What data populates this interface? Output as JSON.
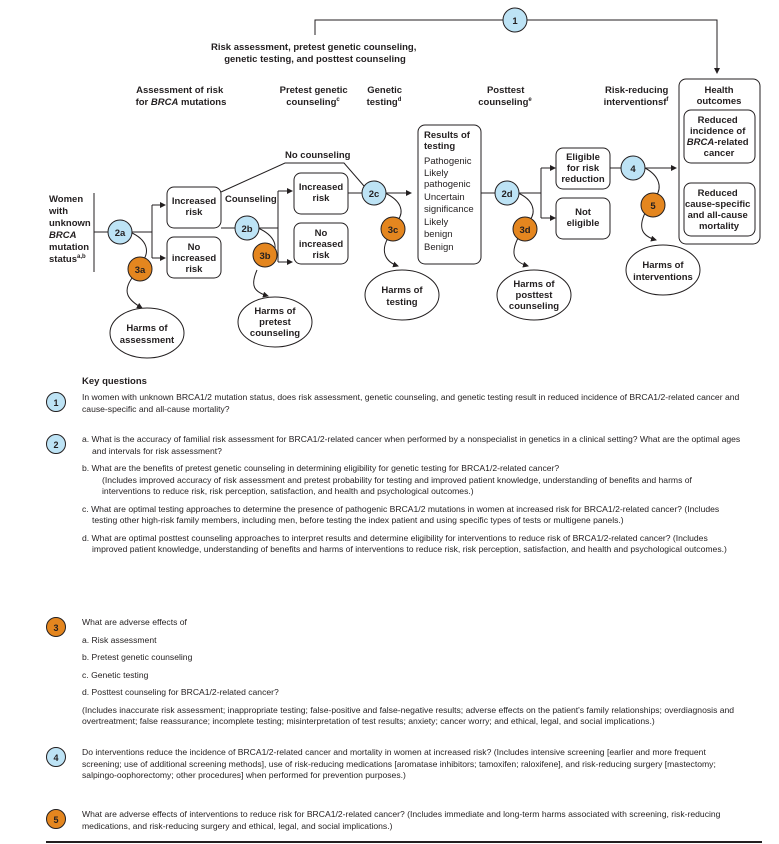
{
  "colors": {
    "kq_benefit": "#bde3f5",
    "kq_harm": "#e4861f",
    "line": "#231f20"
  },
  "diagram": {
    "overarching_label": [
      "Risk assessment, pretest genetic counseling,",
      "genetic testing, and posttest counseling"
    ],
    "kq1": "1",
    "headers": {
      "assessment": [
        "Assessment of risk",
        "for ",
        "BRCA",
        " mutations"
      ],
      "pretest": [
        "Pretest genetic",
        "counseling",
        "c"
      ],
      "genetic_testing": [
        "Genetic",
        "testing",
        "d"
      ],
      "posttest": [
        "Posttest",
        "counseling",
        "e"
      ],
      "risk_reducing": [
        "Risk-reducing",
        "interventionsf",
        "f"
      ]
    },
    "population": [
      "Women",
      "with",
      "unknown",
      "BRCA",
      "mutation",
      "status",
      "a,b"
    ],
    "nodes": {
      "kq2a": "2a",
      "kq3a": "3a",
      "kq2b": "2b",
      "kq3b": "3b",
      "kq2c": "2c",
      "kq3c": "3c",
      "kq2d": "2d",
      "kq3d": "3d",
      "kq4": "4",
      "kq5": "5"
    },
    "boxes": {
      "increased_risk_1": [
        "Increased",
        "risk"
      ],
      "no_increased_risk_1": [
        "No",
        "increased",
        "risk"
      ],
      "increased_risk_2": [
        "Increased",
        "risk"
      ],
      "no_increased_risk_2": [
        "No",
        "increased",
        "risk"
      ],
      "eligible": [
        "Eligible",
        "for risk",
        "reduction"
      ],
      "not_eligible": [
        "Not",
        "eligible"
      ]
    },
    "path_labels": {
      "counseling": "Counseling",
      "no_counseling": "No counseling"
    },
    "results": {
      "title": [
        "Results of",
        "testing"
      ],
      "items": [
        "Pathogenic",
        "Likely",
        "pathogenic",
        "Uncertain",
        "significance",
        "Likely",
        "benign",
        "Benign"
      ]
    },
    "health_outcomes": {
      "title": [
        "Health",
        "outcomes"
      ],
      "incidence": [
        "Reduced",
        "incidence of",
        "BRCA",
        "-related",
        "cancer"
      ],
      "mortality": [
        "Reduced",
        "cause-specific",
        "and all-cause",
        "mortality"
      ]
    },
    "harms": {
      "assessment": [
        "Harms of",
        "assessment"
      ],
      "pretest": [
        "Harms of",
        "pretest",
        "counseling"
      ],
      "testing": [
        "Harms of",
        "testing"
      ],
      "posttest": [
        "Harms of",
        "posttest",
        "counseling"
      ],
      "interventions": [
        "Harms of",
        "interventions"
      ]
    }
  },
  "key_questions": {
    "title": "Key questions",
    "q1": {
      "num": "1",
      "text": "In women with unknown BRCA1/2 mutation status, does risk assessment, genetic counseling, and genetic testing result in reduced incidence of BRCA1/2-related cancer and cause-specific and all-cause mortality?"
    },
    "q2": {
      "num": "2",
      "a": "a. What is the accuracy of familial risk assessment for BRCA1/2-related cancer when performed by a nonspecialist in genetics in a clinical setting? What are the optimal ages and intervals for risk assessment?",
      "b": "b. What are the benefits of pretest genetic counseling in determining eligibility for genetic testing for BRCA1/2-related cancer?",
      "b_note": "(Includes improved accuracy of risk assessment and pretest probability for testing and improved patient knowledge, understanding of benefits and harms of interventions to reduce risk, risk perception, satisfaction, and health and psychological outcomes.)",
      "c": "c. What are optimal testing approaches to determine the presence of pathogenic BRCA1/2 mutations in women at increased risk for BRCA1/2-related cancer? (Includes testing other high-risk family members, including men, before testing the index patient and using specific types of tests or multigene panels.)",
      "d": "d. What are optimal posttest counseling approaches to interpret results and determine eligibility for interventions to reduce risk of BRCA1/2-related cancer? (Includes improved patient knowledge, understanding of benefits and harms of interventions to reduce risk, risk perception, satisfaction, and health and psychological outcomes.)"
    },
    "q3": {
      "num": "3",
      "intro": "What are adverse effects of",
      "a": "a. Risk assessment",
      "b": "b. Pretest genetic counseling",
      "c": "c. Genetic testing",
      "d": "d. Posttest counseling for BRCA1/2-related cancer?",
      "note": "(Includes inaccurate risk assessment; inappropriate testing; false-positive and false-negative results; adverse effects on the patient's family relationships; overdiagnosis and overtreatment; false reassurance; incomplete testing; misinterpretation of test results; anxiety; cancer worry; and ethical, legal, and social implications.)"
    },
    "q4": {
      "num": "4",
      "text": "Do interventions reduce the incidence of BRCA1/2-related cancer and mortality in women at increased risk? (Includes intensive screening [earlier and more frequent screening; use of additional screening methods], use of risk-reducing medications [aromatase inhibitors; tamoxifen; raloxifene], and risk-reducing surgery [mastectomy; salpingo-oophorectomy; other procedures] when performed for prevention purposes.)"
    },
    "q5": {
      "num": "5",
      "text": "What are adverse effects of interventions to reduce risk for BRCA1/2-related cancer? (Includes immediate and long-term harms associated with screening, risk-reducing medications, and risk-reducing surgery and ethical, legal, and social implications.)"
    }
  }
}
